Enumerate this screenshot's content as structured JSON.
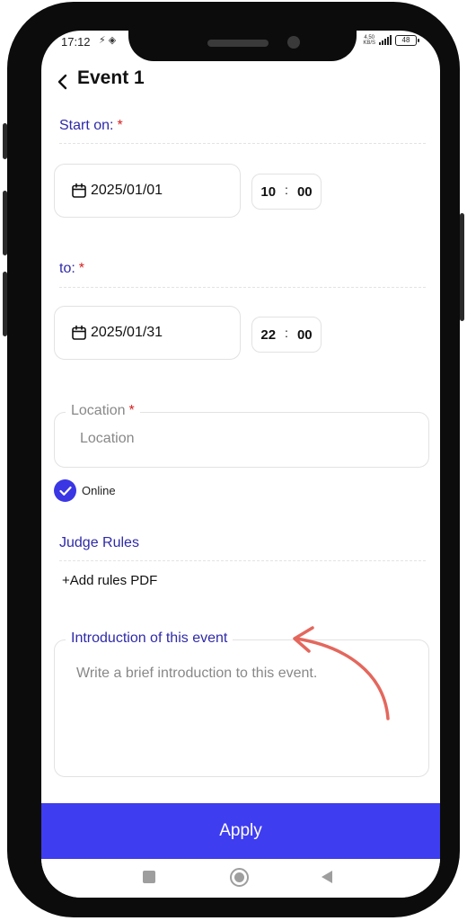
{
  "status_bar": {
    "time": "17:12",
    "left_icons": "⚡ ◈",
    "speed_value": "4.50",
    "speed_unit": "KB/S",
    "battery": "48"
  },
  "header": {
    "back_icon": "chevron-left-icon",
    "title": "Event 1"
  },
  "start": {
    "label": "Start on:",
    "required_mark": "*",
    "date": "2025/01/01",
    "hour": "10",
    "minute": "00",
    "separator": ":"
  },
  "end": {
    "label": "to:",
    "required_mark": "*",
    "date": "2025/01/31",
    "hour": "22",
    "minute": "00",
    "separator": ":"
  },
  "location": {
    "label": "Location",
    "required_mark": "*",
    "placeholder": "Location",
    "value": ""
  },
  "online": {
    "label": "Online",
    "checked": true
  },
  "judge_rules": {
    "label": "Judge Rules",
    "add_pdf_label": "+Add rules PDF"
  },
  "introduction": {
    "label": "Introduction of this event",
    "placeholder": "Write a brief introduction to this event."
  },
  "apply_label": "Apply",
  "colors": {
    "accent": "#3f3df0",
    "label_blue": "#2f2aa8",
    "required_red": "#d62020",
    "annotation_arrow": "#e4675d"
  }
}
